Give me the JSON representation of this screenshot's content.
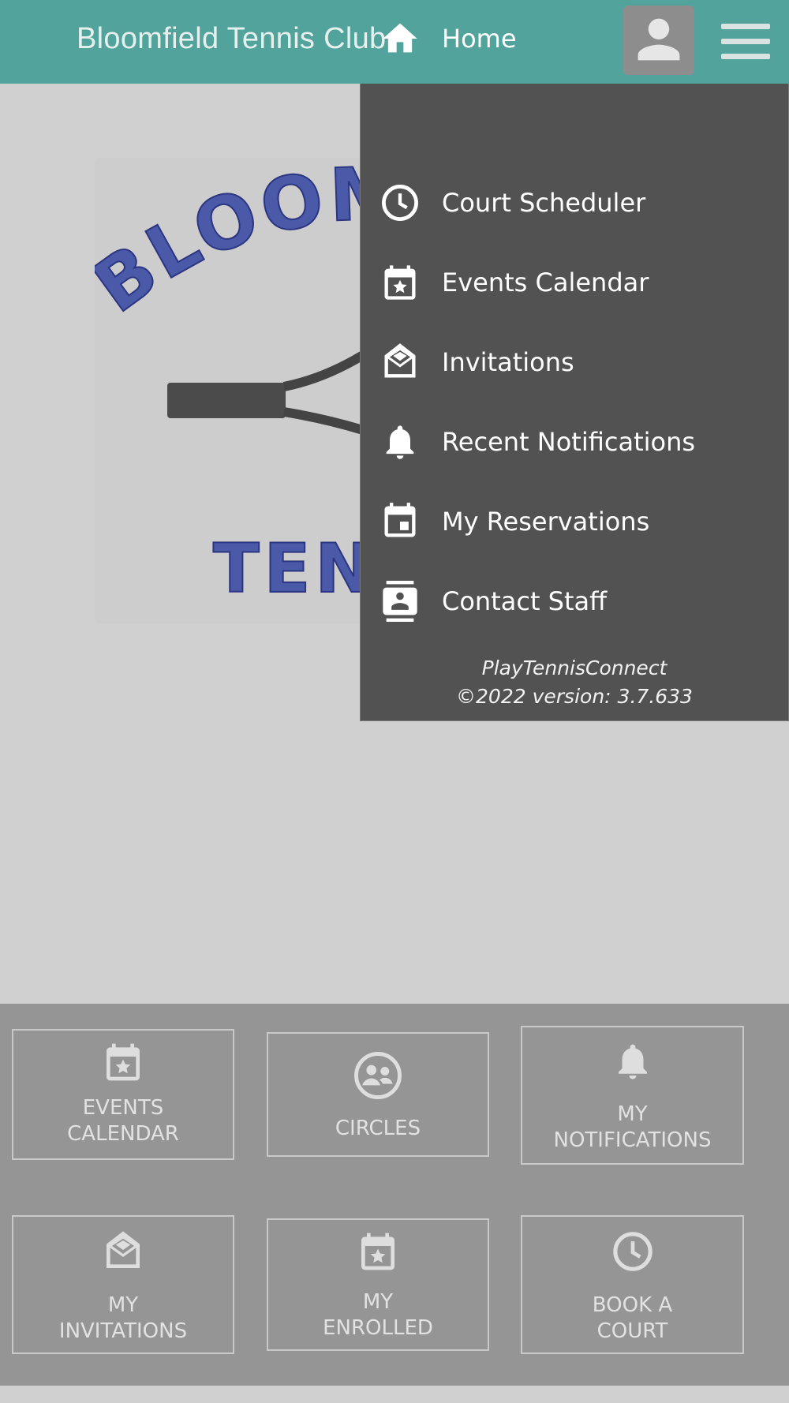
{
  "header": {
    "title": "Bloomfield Tennis Club",
    "avatar_icon": "person-icon",
    "menu_icon": "hamburger-menu-icon"
  },
  "logo": {
    "top_text": "BLOOMFIELD",
    "bottom_text": "TENNIS"
  },
  "menu": {
    "items": [
      {
        "label": "Home",
        "icon": "home-icon"
      },
      {
        "label": "Court Scheduler",
        "icon": "clock-icon"
      },
      {
        "label": "Events Calendar",
        "icon": "calendar-star-icon"
      },
      {
        "label": "Invitations",
        "icon": "envelope-open-icon"
      },
      {
        "label": "Recent Notifications",
        "icon": "bell-icon"
      },
      {
        "label": "My Reservations",
        "icon": "calendar-icon"
      },
      {
        "label": "Contact Staff",
        "icon": "contact-card-icon"
      }
    ],
    "footer_line1": "PlayTennisConnect",
    "footer_line2": "©2022 version: 3.7.633"
  },
  "tiles": [
    {
      "line1": "EVENTS",
      "line2": "CALENDAR",
      "icon": "calendar-star-icon"
    },
    {
      "line1": "CIRCLES",
      "line2": "",
      "icon": "group-circle-icon"
    },
    {
      "line1": "MY",
      "line2": "NOTIFICATIONS",
      "icon": "bell-icon"
    },
    {
      "line1": "MY",
      "line2": "INVITATIONS",
      "icon": "envelope-open-icon"
    },
    {
      "line1": "MY",
      "line2": "ENROLLED",
      "icon": "calendar-star-icon"
    },
    {
      "line1": "BOOK A",
      "line2": "COURT",
      "icon": "clock-icon"
    }
  ],
  "colors": {
    "header_bg": "#52a39b",
    "menu_bg": "#525252",
    "tile_panel_bg": "#959595"
  }
}
